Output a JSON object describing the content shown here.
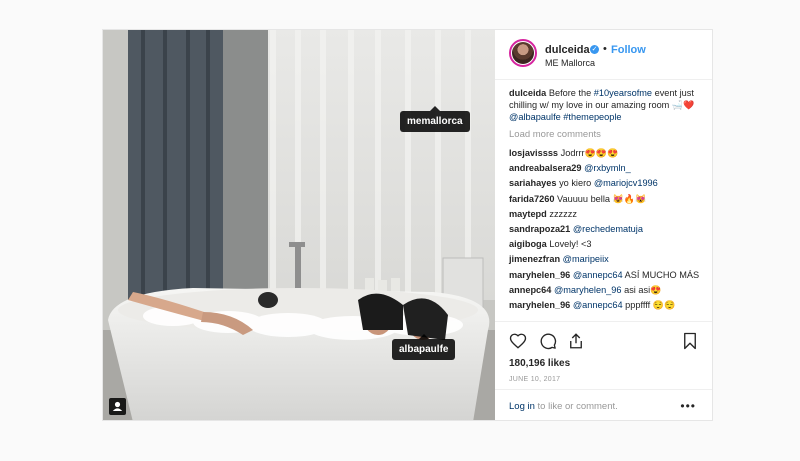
{
  "header": {
    "username": "dulceida",
    "follow_label": "Follow",
    "dot": "•",
    "location": "ME Mallorca"
  },
  "photo_tags": {
    "tag1": "memallorca",
    "tag2": "albapaulfe"
  },
  "caption": {
    "user": "dulceida",
    "text_before": "Before the ",
    "hashtag1": "#10yearsofme",
    "text_after": " event just chilling w/ my love in our amazing room",
    "emojis": "🛁❤️",
    "mention": "@albapaulfe",
    "hashtag2": "#themepeople"
  },
  "load_more": "Load more comments",
  "comments": [
    {
      "user": "losjavissss",
      "text": "Jodrrr",
      "emoji": "😍😍😍"
    },
    {
      "user": "andreabalsera29",
      "mention": "@rxbymln_"
    },
    {
      "user": "sariahayes",
      "text": "yo kiero",
      "mention": "@mariojcv1996"
    },
    {
      "user": "farida7260",
      "text": "Vauuuu bella",
      "emoji": "😻🔥😻"
    },
    {
      "user": "maytepd",
      "text": "zzzzzz"
    },
    {
      "user": "sandrapoza21",
      "mention": "@rechedematuja"
    },
    {
      "user": "aigiboga",
      "text": "Lovely! <3"
    },
    {
      "user": "jimenezfran",
      "mention": "@maripeiix"
    },
    {
      "user": "maryhelen_96",
      "mention": "@annepc64",
      "text": "ASÍ MUCHO MÁS"
    },
    {
      "user": "annepc64",
      "mention": "@maryhelen_96",
      "text": "asi asi",
      "emoji": "😍"
    },
    {
      "user": "maryhelen_96",
      "mention": "@annepc64",
      "text": "pppffff",
      "emoji": "😌😌"
    }
  ],
  "likes": "180,196 likes",
  "date": "JUNE 10, 2017",
  "footer": {
    "login": "Log in",
    "login_rest": " to like or comment.",
    "more": "•••"
  },
  "icons": {
    "like": "heart-icon",
    "comment": "comment-icon",
    "share": "share-icon",
    "save": "bookmark-icon",
    "verified": "verified-badge-icon",
    "user_tag": "user-tag-icon"
  },
  "colors": {
    "link": "#003569",
    "follow": "#3897f0",
    "muted": "#999999"
  }
}
